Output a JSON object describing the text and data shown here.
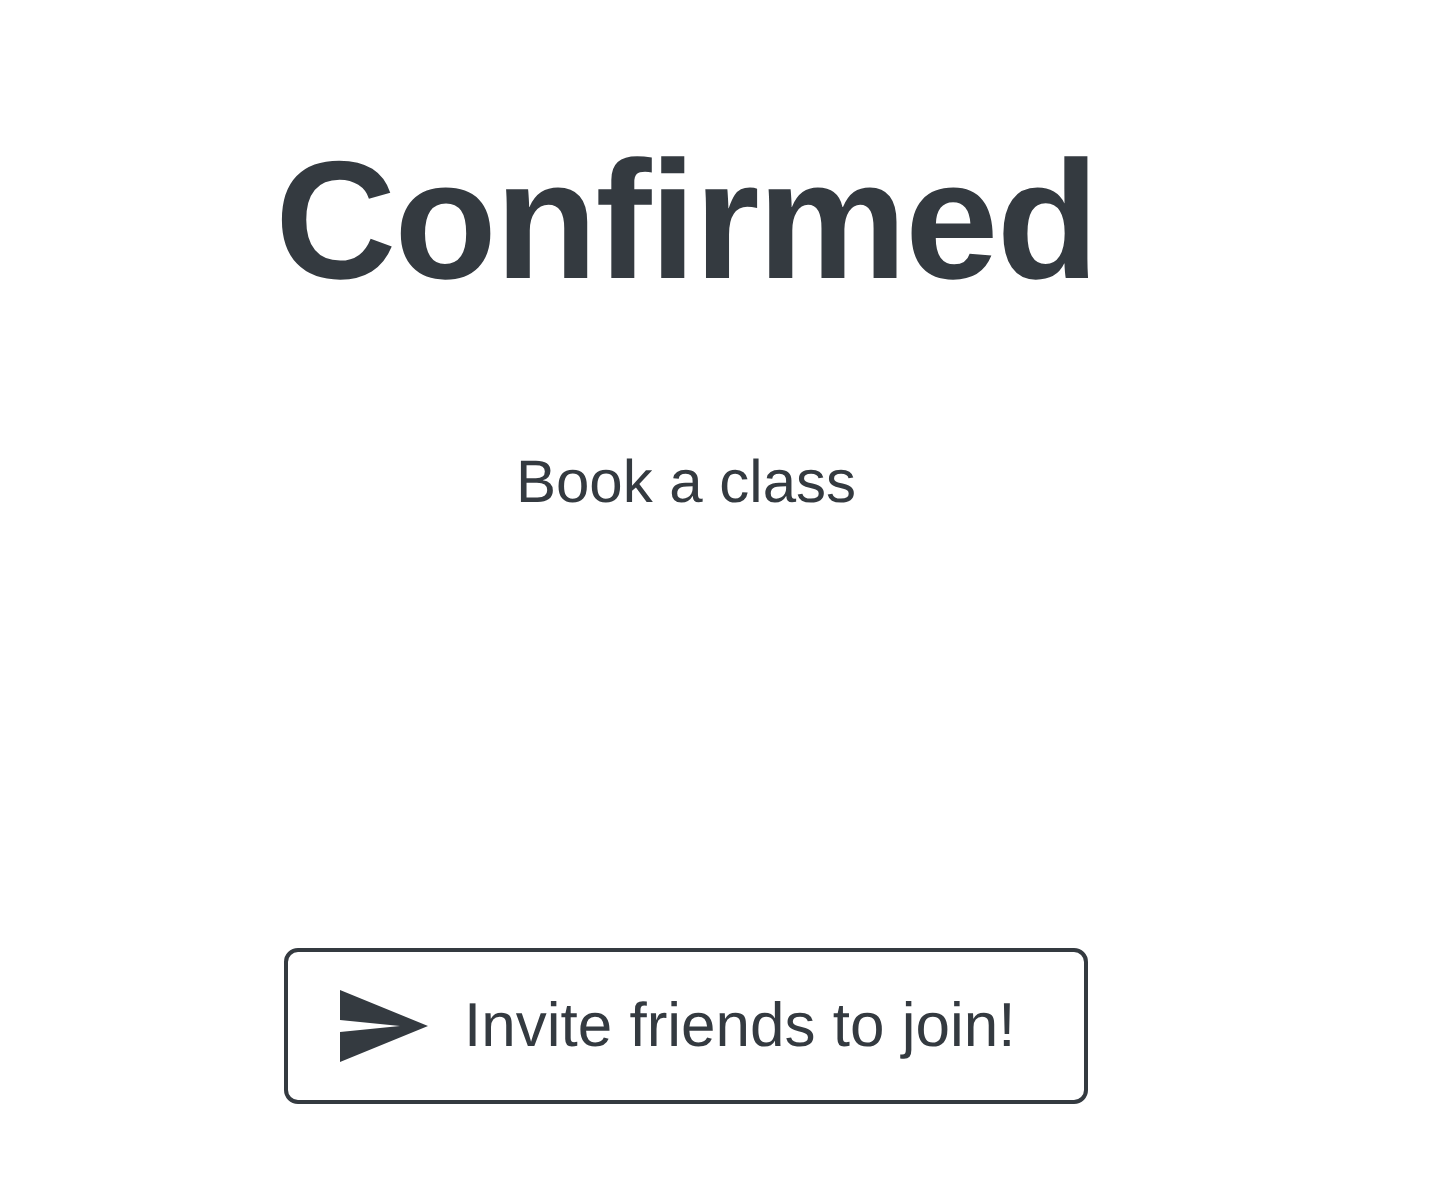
{
  "heading": "Confirmed",
  "subtitle": "Book a class",
  "invite_button": {
    "label": "Invite friends to join!"
  }
}
